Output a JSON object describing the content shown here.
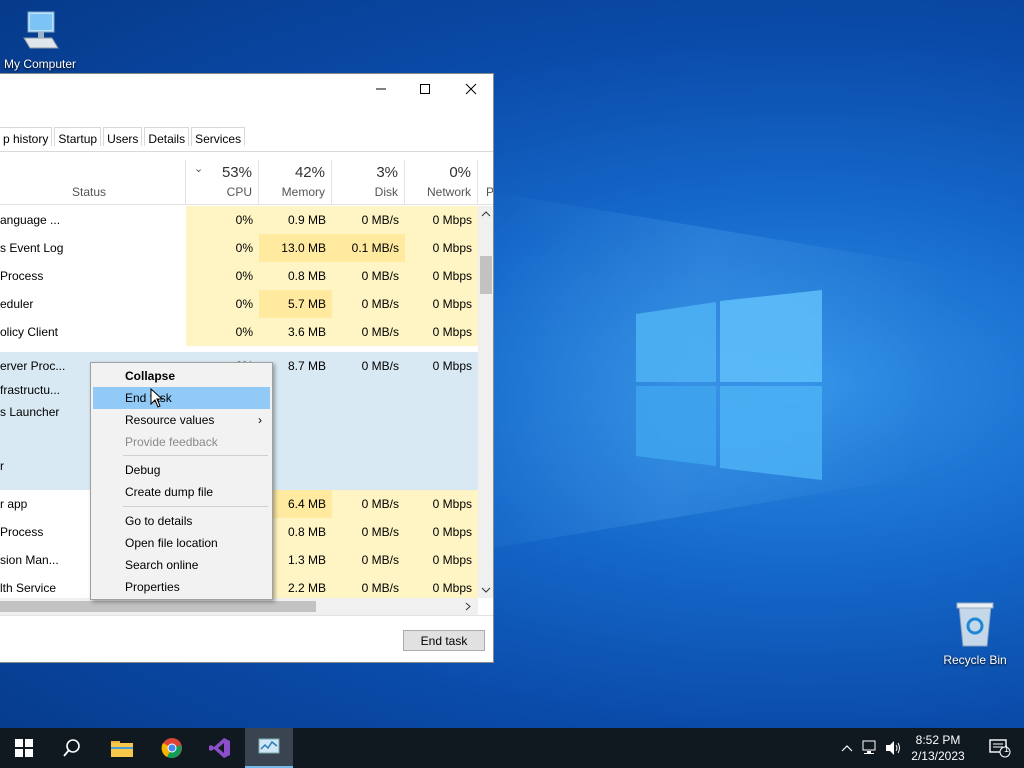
{
  "desktop": {
    "my_computer_label": "My Computer",
    "recycle_bin_label": "Recycle Bin"
  },
  "taskmanager": {
    "tabs": [
      "p history",
      "Startup",
      "Users",
      "Details",
      "Services"
    ],
    "header": {
      "cpu_pct": "53%",
      "cpu_label": "CPU",
      "mem_pct": "42%",
      "mem_label": "Memory",
      "disk_pct": "3%",
      "disk_label": "Disk",
      "net_pct": "0%",
      "net_label": "Network",
      "status_label": "Status",
      "power_label": "P"
    },
    "rows": [
      {
        "name": "anguage ...",
        "cpu": "0%",
        "mem": "0.9 MB",
        "disk": "0 MB/s",
        "net": "0 Mbps"
      },
      {
        "name": "s Event Log",
        "cpu": "0%",
        "mem": "13.0 MB",
        "disk": "0.1 MB/s",
        "net": "0 Mbps"
      },
      {
        "name": "Process",
        "cpu": "0%",
        "mem": "0.8 MB",
        "disk": "0 MB/s",
        "net": "0 Mbps"
      },
      {
        "name": "eduler",
        "cpu": "0%",
        "mem": "5.7 MB",
        "disk": "0 MB/s",
        "net": "0 Mbps"
      },
      {
        "name": "olicy Client",
        "cpu": "0%",
        "mem": "3.6 MB",
        "disk": "0 MB/s",
        "net": "0 Mbps"
      }
    ],
    "group": {
      "name": "erver Proc...",
      "cpu": "0%",
      "mem": "8.7 MB",
      "disk": "0 MB/s",
      "net": "0 Mbps",
      "children": [
        "frastructu...",
        "s Launcher",
        "r"
      ]
    },
    "rows_after": [
      {
        "name": "r app",
        "cpu": "",
        "mem": "6.4 MB",
        "disk": "0 MB/s",
        "net": "0 Mbps"
      },
      {
        "name": "Process",
        "cpu": "",
        "mem": "0.8 MB",
        "disk": "0 MB/s",
        "net": "0 Mbps"
      },
      {
        "name": "sion Man...",
        "cpu": "",
        "mem": "1.3 MB",
        "disk": "0 MB/s",
        "net": "0 Mbps"
      },
      {
        "name": "lth Service",
        "cpu": "",
        "mem": "2.2 MB",
        "disk": "0 MB/s",
        "net": "0 Mbps"
      }
    ],
    "end_task_button": "End task"
  },
  "context_menu": {
    "collapse": "Collapse",
    "end_task": "End task",
    "resource_values": "Resource values",
    "provide_feedback": "Provide feedback",
    "debug": "Debug",
    "create_dump": "Create dump file",
    "go_to_details": "Go to details",
    "open_file_location": "Open file location",
    "search_online": "Search online",
    "properties": "Properties"
  },
  "taskbar": {
    "time": "8:52 PM",
    "date": "2/13/2023",
    "notification_count": "1"
  },
  "colors": {
    "accent_highlight": "#91c9f7",
    "heat_yellow": "#fff4c4",
    "group_blue": "#d9e9f3"
  }
}
